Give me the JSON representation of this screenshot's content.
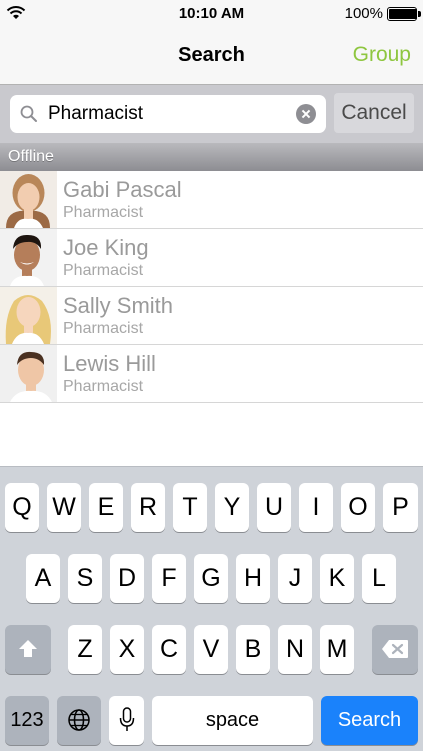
{
  "status": {
    "time": "10:10 AM",
    "battery": "100%",
    "battery_level": 1.0
  },
  "navbar": {
    "title": "Search",
    "right_button": "Group"
  },
  "search": {
    "value": "Pharmacist",
    "cancel_label": "Cancel"
  },
  "section": {
    "title": "Offline"
  },
  "contacts": [
    {
      "name": "Gabi Pascal",
      "role": "Pharmacist"
    },
    {
      "name": "Joe King",
      "role": "Pharmacist"
    },
    {
      "name": "Sally Smith",
      "role": "Pharmacist"
    },
    {
      "name": "Lewis Hill",
      "role": "Pharmacist"
    }
  ],
  "keyboard": {
    "row1": [
      "Q",
      "W",
      "E",
      "R",
      "T",
      "Y",
      "U",
      "I",
      "O",
      "P"
    ],
    "row2": [
      "A",
      "S",
      "D",
      "F",
      "G",
      "H",
      "J",
      "K",
      "L"
    ],
    "row3": [
      "Z",
      "X",
      "C",
      "V",
      "B",
      "N",
      "M"
    ],
    "numbers_label": "123",
    "space_label": "space",
    "search_label": "Search"
  },
  "colors": {
    "accent": "#8ec63f",
    "search_key": "#1a82fb"
  }
}
